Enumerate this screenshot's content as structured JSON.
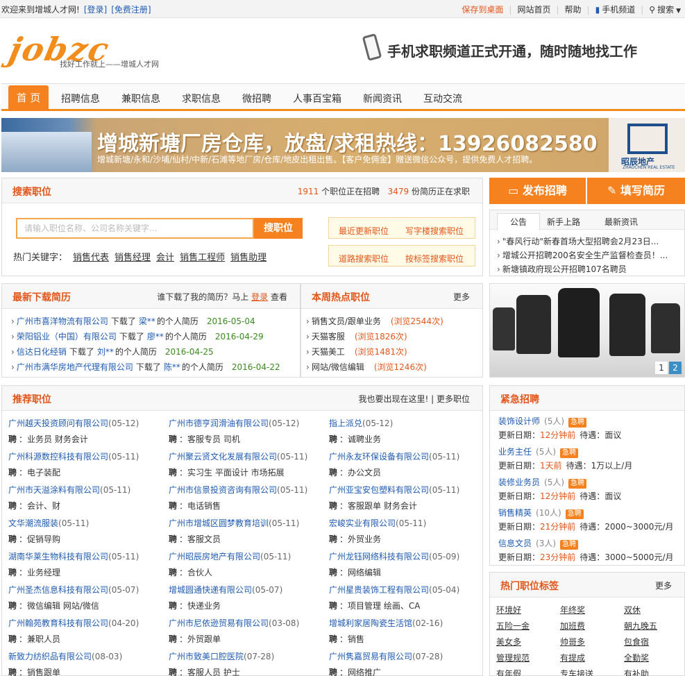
{
  "topbar": {
    "welcome": "欢迎来到增城人才网!",
    "login": "[登录]",
    "register": "[免费注册]",
    "save_desktop": "保存到桌面",
    "home": "网站首页",
    "help": "帮助",
    "mobile": "手机频道",
    "search": "搜索"
  },
  "header": {
    "logo_text": "jobzc",
    "logo_slogan": "找好工作就上——增城人才网",
    "mobile_ad": "手机求职频道正式开通，随时随地找工作"
  },
  "nav": {
    "items": [
      "首 页",
      "招聘信息",
      "兼职信息",
      "求职信息",
      "微招聘",
      "人事百宝箱",
      "新闻资讯",
      "互动交流"
    ]
  },
  "banner": {
    "title": "增城新塘厂房仓库，放盘/求租热线：13926082580",
    "subtitle": "增城新塘/永和/沙埔/仙村/中新/石滩等地厂房/仓库/地皮出租出售。【客户免佣金】赠送微信公众号，提供免费人才招聘。",
    "logo_name": "昭辰地产",
    "logo_en": "ZHAOCHEN REAL ESTATE"
  },
  "search": {
    "title": "搜索职位",
    "job_count": "1911",
    "job_count_text": "个职位正在招聘",
    "resume_count": "3479",
    "resume_count_text": "份简历正在求职",
    "placeholder": "请输入职位名称、公司名称关键字...",
    "button": "搜职位",
    "hot_label": "热门关键字：",
    "hot_keywords": [
      "销售代表",
      "销售经理",
      "会计",
      "销售工程师",
      "销售助理"
    ],
    "quick": [
      "最近更新职位",
      "写字楼搜索职位",
      "道路搜索职位",
      "按标签搜索职位"
    ]
  },
  "actions": {
    "post_job": "发布招聘",
    "fill_resume": "填写简历"
  },
  "notice": {
    "tabs": [
      "公告",
      "新手上路",
      "最新资讯"
    ],
    "items": [
      "\"春风行动\"新春首场大型招聘会2月23日...",
      "增城公开招聘200名安全生产监督检查员！...",
      "新塘镇政府现公开招聘107名聘员"
    ]
  },
  "downloads": {
    "title": "最新下载简历",
    "hint": "谁下载了我的简历？马上",
    "hint_login": "登录",
    "hint_end": "查看",
    "items": [
      {
        "company": "广州市喜洋物流有限公司",
        "action": "下载了",
        "person": "梁**",
        "suffix": "的个人简历",
        "date": "2016-05-04"
      },
      {
        "company": "荣阳铝业（中国）有限公司",
        "action": "下载了",
        "person": "廖**",
        "suffix": "的个人简历",
        "date": "2016-04-29"
      },
      {
        "company": "信达日化经销",
        "action": "下载了",
        "person": "刘**",
        "suffix": "的个人简历",
        "date": "2016-04-25"
      },
      {
        "company": "广州市满华房地产代理有限公司",
        "action": "下载了",
        "person": "陈**",
        "suffix": "的个人简历",
        "date": "2016-04-22"
      }
    ]
  },
  "hotjobs": {
    "title": "本周热点职位",
    "more": "更多",
    "items": [
      {
        "name": "销售文员/跟单业务",
        "views": "(浏览2544次)"
      },
      {
        "name": "天猫客服",
        "views": "(浏览1826次)"
      },
      {
        "name": "天猫美工",
        "views": "(浏览1481次)"
      },
      {
        "name": "网站/微信编辑",
        "views": "(浏览1246次)"
      }
    ]
  },
  "slider": {
    "pages": [
      "1",
      "2"
    ]
  },
  "recommend": {
    "title": "推荐职位",
    "cta": "我也要出现在这里!",
    "more": "| 更多职位",
    "pin": "聘",
    "rows": [
      [
        {
          "c": "广州越天投资顾问有限公司",
          "d": "(05-12)",
          "p": "业务员 财务会计"
        },
        {
          "c": "广州市德亨润滑油有限公司",
          "d": "(05-12)",
          "p": "客服专员 司机"
        },
        {
          "c": "指上派兑",
          "d": "(05-12)",
          "p": "诚聘业务"
        }
      ],
      [
        {
          "c": "广州科源数控科技有限公司",
          "d": "(05-11)",
          "p": "电子装配"
        },
        {
          "c": "广州聚云贤文化发展有限公司",
          "d": "(05-11)",
          "p": "实习生 平面设计 市场拓展"
        },
        {
          "c": "广州永友环保设备有限公司",
          "d": "(05-11)",
          "p": "办公文员"
        }
      ],
      [
        {
          "c": "广州市天溢涂料有限公司",
          "d": "(05-11)",
          "p": "会计、财"
        },
        {
          "c": "广州市信景投资咨询有限公司",
          "d": "(05-11)",
          "p": "电话销售"
        },
        {
          "c": "广州亚宝安包塑料有限公司",
          "d": "(05-11)",
          "p": "客服跟单 财务会计"
        }
      ],
      [
        {
          "c": "文华潮流服装",
          "d": "(05-11)",
          "p": "促销导购"
        },
        {
          "c": "广州市增城区圆梦教育培训",
          "d": "(05-11)",
          "p": "客服文员"
        },
        {
          "c": "宏峻实业有限公司",
          "d": "(05-11)",
          "p": "外贸业务"
        }
      ],
      [
        {
          "c": "湖南华莱生物科技有限公司",
          "d": "(05-11)",
          "p": "业务经理"
        },
        {
          "c": "广州昭辰房地产有限公司",
          "d": "(05-11)",
          "p": "合伙人"
        },
        {
          "c": "广州龙钰网络科技有限公司",
          "d": "(05-09)",
          "p": "网络编辑"
        }
      ],
      [
        {
          "c": "广州圣杰信息科技有限公司",
          "d": "(05-07)",
          "p": "微信编辑 网站/微信"
        },
        {
          "c": "增城圆通快递有限公司",
          "d": "(05-07)",
          "p": "快递业务"
        },
        {
          "c": "广州星贵装饰工程有限公司",
          "d": "(05-04)",
          "p": "项目管理 绘画、CA"
        }
      ],
      [
        {
          "c": "广州翰苑教育科技有限公司",
          "d": "(04-20)",
          "p": "兼职人员"
        },
        {
          "c": "广州市尼依逊贸易有限公司",
          "d": "(03-08)",
          "p": "外贸跟单"
        },
        {
          "c": "增城利家居陶瓷生活馆",
          "d": "(02-16)",
          "p": "销售"
        }
      ],
      [
        {
          "c": "新致力纺织品有限公司",
          "d": "(08-03)",
          "p": "销售跟单"
        },
        {
          "c": "广州市致美口腔医院",
          "d": "(07-28)",
          "p": "客服人员 护士"
        },
        {
          "c": "广州隽嘉贸易有限公司",
          "d": "(07-28)",
          "p": "网络推广"
        }
      ]
    ]
  },
  "urgent": {
    "title": "紧急招聘",
    "badge": "急聘",
    "update_label": "更新日期：",
    "pay_label": "待遇：",
    "items": [
      {
        "name": "装饰设计师",
        "count": "(5人)",
        "time": "12分钟前",
        "pay": "面议"
      },
      {
        "name": "业务主任",
        "count": "(5人)",
        "time": "1天前",
        "pay": "1万以上/月"
      },
      {
        "name": "装修业务员",
        "count": "(5人)",
        "time": "12分钟前",
        "pay": "面议"
      },
      {
        "name": "销售精英",
        "count": "(10人)",
        "time": "21分钟前",
        "pay": "2000~3000元/月"
      },
      {
        "name": "信息文员",
        "count": "(3人)",
        "time": "23分钟前",
        "pay": "3000~5000元/月"
      }
    ]
  },
  "hottags": {
    "title": "热门职位标签",
    "more": "更多",
    "tags": [
      "环境好",
      "年终奖",
      "双休",
      "五险一金",
      "加班费",
      "朝九晚五",
      "美女多",
      "帅哥多",
      "包食宿",
      "管理规范",
      "有提成",
      "全勤奖",
      "有年假",
      "专车接送",
      "有补助"
    ]
  }
}
